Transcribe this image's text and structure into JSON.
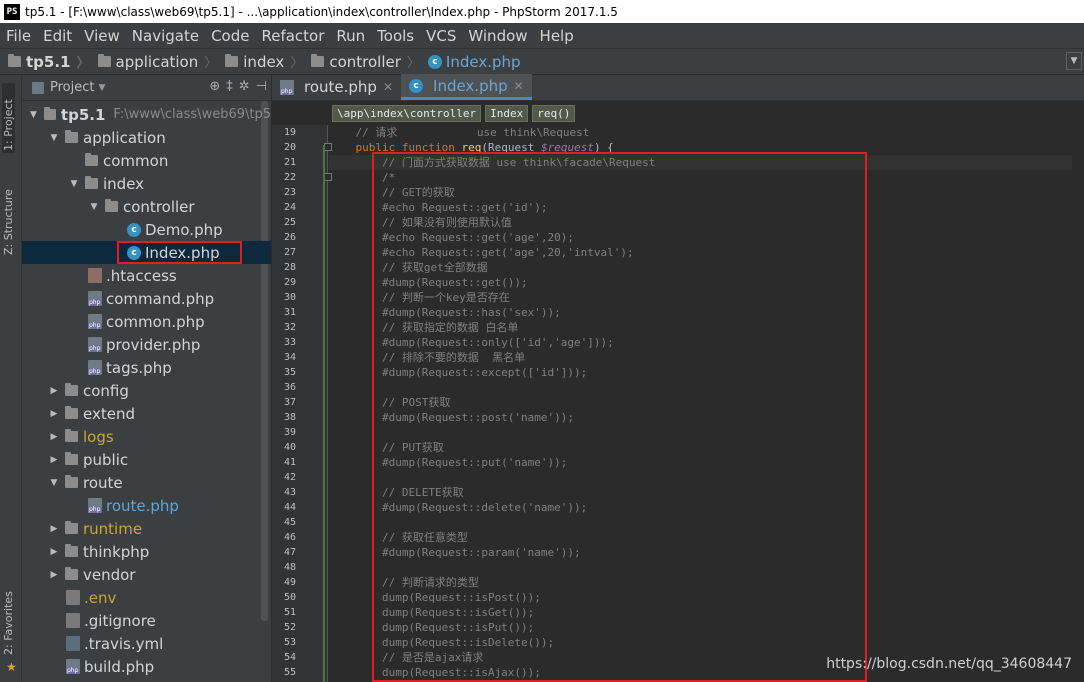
{
  "window": {
    "title": "tp5.1 - [F:\\www\\class\\web69\\tp5.1] - ...\\application\\index\\controller\\Index.php - PhpStorm 2017.1.5"
  },
  "menu": [
    "File",
    "Edit",
    "View",
    "Navigate",
    "Code",
    "Refactor",
    "Run",
    "Tools",
    "VCS",
    "Window",
    "Help"
  ],
  "navbar": {
    "crumbs": [
      "tp5.1",
      "application",
      "index",
      "controller",
      "Index.php"
    ]
  },
  "side_tabs": {
    "project": "1: Project",
    "structure": "Z: Structure",
    "favorites": "2: Favorites"
  },
  "project_panel": {
    "header": "Project",
    "root_label": "tp5.1",
    "root_path": "F:\\www\\class\\web69\\tp5",
    "items": [
      "application",
      "common",
      "index",
      "controller",
      "Demo.php",
      "Index.php",
      ".htaccess",
      "command.php",
      "common.php",
      "provider.php",
      "tags.php",
      "config",
      "extend",
      "logs",
      "public",
      "route",
      "route.php",
      "runtime",
      "thinkphp",
      "vendor",
      ".env",
      ".gitignore",
      ".travis.yml",
      "build.php"
    ]
  },
  "editor": {
    "tabs": [
      "route.php",
      "Index.php"
    ],
    "breadcrumb": [
      "\\app\\index\\controller",
      "Index",
      "req()"
    ],
    "line_numbers": [
      "19",
      "20",
      "21",
      "22",
      "23",
      "24",
      "25",
      "26",
      "27",
      "28",
      "29",
      "30",
      "31",
      "32",
      "33",
      "34",
      "35",
      "36",
      "37",
      "38",
      "39",
      "40",
      "41",
      "42",
      "43",
      "44",
      "45",
      "46",
      "47",
      "48",
      "49",
      "50",
      "51",
      "52",
      "53",
      "54",
      "55"
    ],
    "code": {
      "l19": "    // 请求            use think\\Request",
      "l20_kw1": "    public ",
      "l20_kw2": "function ",
      "l20_fn": "req",
      "l20_a": "(Request ",
      "l20_var": "$request",
      "l20_b": ") {",
      "l21": "        // 门面方式获取数据 use think\\facade\\Request",
      "l22": "        /*",
      "l23": "        // GET的获取",
      "l24": "        #echo Request::get('id');",
      "l25": "        // 如果没有则使用默认值",
      "l26": "        #echo Request::get('age',20);",
      "l27": "        #echo Request::get('age',20,'intval');",
      "l28": "        // 获取get全部数据",
      "l29": "        #dump(Request::get());",
      "l30": "        // 判断一个key是否存在",
      "l31": "        #dump(Request::has('sex'));",
      "l32": "        // 获取指定的数据 白名单",
      "l33": "        #dump(Request::only(['id','age']));",
      "l34": "        // 排除不要的数据  黑名单",
      "l35": "        #dump(Request::except(['id']));",
      "l36": "",
      "l37": "        // POST获取",
      "l38": "        #dump(Request::post('name'));",
      "l39": "",
      "l40": "        // PUT获取",
      "l41": "        #dump(Request::put('name'));",
      "l42": "",
      "l43": "        // DELETE获取",
      "l44": "        #dump(Request::delete('name'));",
      "l45": "",
      "l46": "        // 获取任意类型",
      "l47": "        #dump(Request::param('name'));",
      "l48": "",
      "l49": "        // 判断请求的类型",
      "l50": "        dump(Request::isPost());",
      "l51": "        dump(Request::isGet());",
      "l52": "        dump(Request::isPut());",
      "l53": "        dump(Request::isDelete());",
      "l54": "        // 是否是ajax请求",
      "l55": "        dump(Request::isAjax());"
    }
  },
  "watermark": "https://blog.csdn.net/qq_34608447",
  "colors": {
    "selection": "#0d293e",
    "highlight_box": "#e02020",
    "tab_underline": "#4a88c7"
  }
}
